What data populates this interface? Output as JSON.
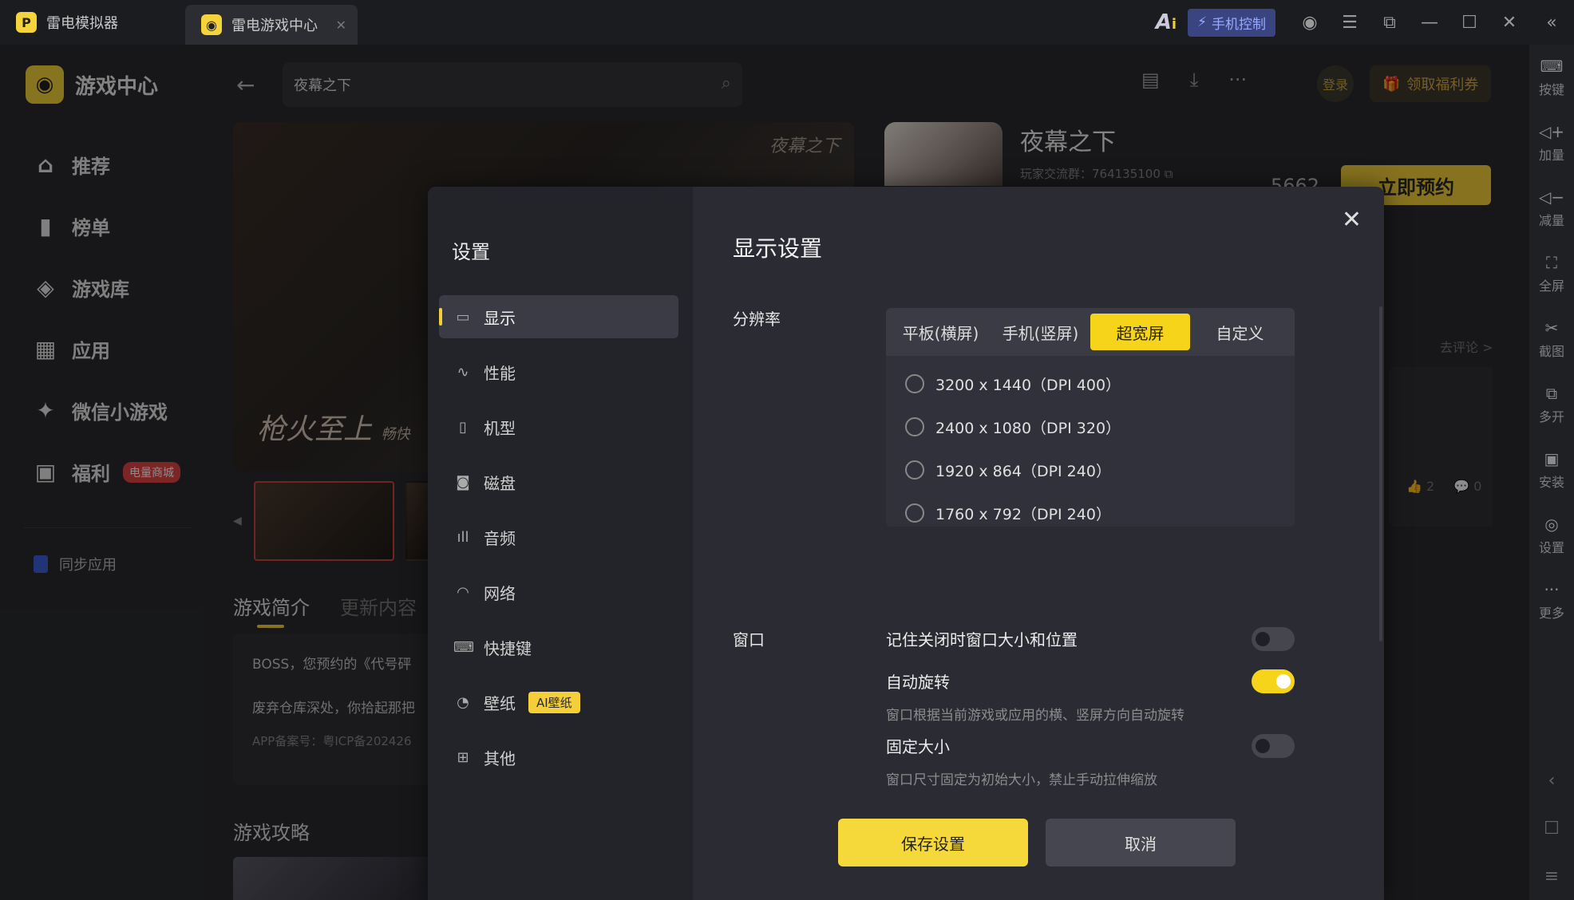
{
  "titlebar": {
    "tabs": [
      {
        "label": "雷电模拟器",
        "close": ""
      },
      {
        "label": "雷电游戏中心",
        "close": "✕"
      }
    ],
    "ai_label": "A",
    "phone_control": "手机控制"
  },
  "rail": {
    "items": [
      {
        "label": "按键",
        "icon": "keyboard-icon"
      },
      {
        "label": "加量",
        "icon": "volume-up-icon"
      },
      {
        "label": "减量",
        "icon": "volume-down-icon"
      },
      {
        "label": "全屏",
        "icon": "fullscreen-icon"
      },
      {
        "label": "截图",
        "icon": "scissors-icon"
      },
      {
        "label": "多开",
        "icon": "multi-instance-icon"
      },
      {
        "label": "安装",
        "icon": "apk-install-icon"
      },
      {
        "label": "设置",
        "icon": "settings-icon"
      },
      {
        "label": "更多",
        "icon": "more-icon"
      }
    ]
  },
  "sidebar": {
    "brand": "游戏中心",
    "items": [
      {
        "label": "推荐",
        "icon": "home-icon"
      },
      {
        "label": "榜单",
        "icon": "ranking-icon"
      },
      {
        "label": "游戏库",
        "icon": "gamepad-icon"
      },
      {
        "label": "应用",
        "icon": "apps-icon"
      },
      {
        "label": "微信小游戏",
        "icon": "wechat-game-icon"
      },
      {
        "label": "福利",
        "icon": "gift-icon",
        "badge": "电量商城"
      }
    ],
    "sync": "同步应用"
  },
  "header": {
    "search_value": "夜幕之下",
    "login": "登录",
    "coupon": "领取福利券"
  },
  "game": {
    "banner_title": "枪火至上",
    "banner_sub": "畅快",
    "banner_logo": "夜幕之下",
    "name": "夜幕之下",
    "qq_group": "玩家交流群：764135100",
    "count": "5662",
    "reserve": "立即预约",
    "tab_intro": "游戏简介",
    "tab_update": "更新内容",
    "desc_line1": "BOSS，您预约的《代号砰",
    "desc_line2": "废弃仓库深处，你拾起那把",
    "icp": "APP备案号：粤ICP备202426",
    "guide_title": "游戏攻略",
    "comment_link": "去评论 >",
    "likes": "2",
    "comments": "0"
  },
  "settings": {
    "side_title": "设置",
    "menu": [
      {
        "label": "显示",
        "icon": "monitor-icon"
      },
      {
        "label": "性能",
        "icon": "performance-icon"
      },
      {
        "label": "机型",
        "icon": "phone-model-icon"
      },
      {
        "label": "磁盘",
        "icon": "disk-icon"
      },
      {
        "label": "音频",
        "icon": "audio-icon"
      },
      {
        "label": "网络",
        "icon": "wifi-icon"
      },
      {
        "label": "快捷键",
        "icon": "keyboard-icon"
      },
      {
        "label": "壁纸",
        "icon": "palette-icon",
        "badge": "AI壁纸"
      },
      {
        "label": "其他",
        "icon": "grid-icon"
      }
    ],
    "title": "显示设置",
    "resolution_label": "分辨率",
    "resolution_tabs": [
      "平板(横屏)",
      "手机(竖屏)",
      "超宽屏",
      "自定义"
    ],
    "resolution_active": "超宽屏",
    "resolutions": [
      "3200 x 1440（DPI 400）",
      "2400 x 1080（DPI 320）",
      "1920 x 864（DPI 240）",
      "1760 x 792（DPI 240）"
    ],
    "window_label": "窗口",
    "window_options": [
      {
        "title": "记住关闭时窗口大小和位置",
        "desc": "",
        "on": false
      },
      {
        "title": "自动旋转",
        "desc": "窗口根据当前游戏或应用的横、竖屏方向自动旋转",
        "on": true
      },
      {
        "title": "固定大小",
        "desc": "窗口尺寸固定为初始大小，禁止手动拉伸缩放",
        "on": false
      }
    ],
    "save": "保存设置",
    "cancel": "取消",
    "accent": "#f5d41a"
  }
}
